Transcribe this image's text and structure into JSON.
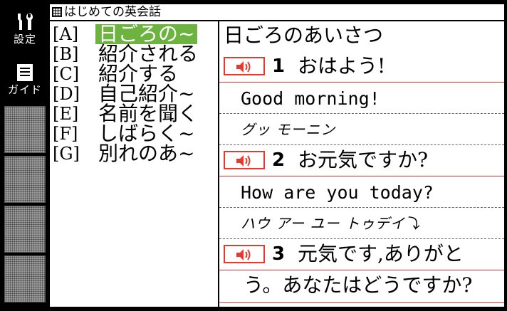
{
  "sidebar": {
    "settings_label": "設定",
    "guide_label": "ガイド",
    "settings_icon": "tools-icon",
    "guide_icon": "document-icon"
  },
  "header": {
    "title": "はじめての英会話"
  },
  "index": [
    {
      "key": "[A]",
      "label": "日ごろの~",
      "selected": true
    },
    {
      "key": "[B]",
      "label": "紹介される",
      "selected": false
    },
    {
      "key": "[C]",
      "label": "紹介する",
      "selected": false
    },
    {
      "key": "[D]",
      "label": "自己紹介~",
      "selected": false
    },
    {
      "key": "[E]",
      "label": "名前を聞く",
      "selected": false
    },
    {
      "key": "[F]",
      "label": "しばらく~",
      "selected": false
    },
    {
      "key": "[G]",
      "label": "別れのあ~",
      "selected": false
    }
  ],
  "content": {
    "heading": "日ごろのあいさつ",
    "items": [
      {
        "num": "1",
        "phrase": "おはよう!",
        "english": "Good morning!",
        "kana": "グッ モーニン"
      },
      {
        "num": "2",
        "phrase": "お元気ですか?",
        "english": "How are you today?",
        "kana": "ハウ アー ユー トゥデイ⤵"
      },
      {
        "num": "3",
        "phrase": "元気です,ありがと",
        "phrase_cont": "う。あなたはどうですか?"
      }
    ]
  },
  "colors": {
    "selection": "#6cb33f",
    "speaker_border": "#e53a2f",
    "frame": "#000000"
  }
}
